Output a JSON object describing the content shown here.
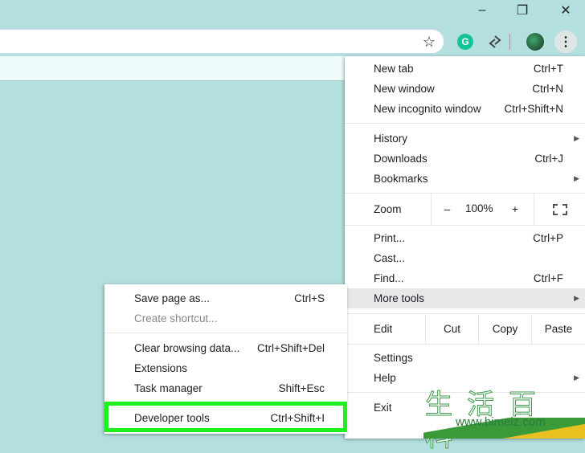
{
  "window": {
    "minimize": "–",
    "restore": "❐",
    "close": "✕"
  },
  "toolbar": {
    "icons": [
      "star-icon",
      "grammarly-icon",
      "extension-icon",
      "avatar",
      "menu-dots-icon"
    ],
    "grammarly_letter": "G",
    "accent": "#15c39a"
  },
  "menu": {
    "top": [
      {
        "label": "New tab",
        "shortcut": "Ctrl+T"
      },
      {
        "label": "New window",
        "shortcut": "Ctrl+N"
      },
      {
        "label": "New incognito window",
        "shortcut": "Ctrl+Shift+N"
      }
    ],
    "mid": [
      {
        "label": "History",
        "shortcut": ""
      },
      {
        "label": "Downloads",
        "shortcut": "Ctrl+J"
      },
      {
        "label": "Bookmarks",
        "shortcut": ""
      }
    ],
    "zoom": {
      "label": "Zoom",
      "minus": "–",
      "value": "100%",
      "plus": "+"
    },
    "tools": [
      {
        "label": "Print...",
        "shortcut": "Ctrl+P"
      },
      {
        "label": "Cast...",
        "shortcut": ""
      },
      {
        "label": "Find...",
        "shortcut": "Ctrl+F"
      },
      {
        "label": "More tools",
        "shortcut": ""
      }
    ],
    "edit": {
      "label": "Edit",
      "cut": "Cut",
      "copy": "Copy",
      "paste": "Paste"
    },
    "bottom": [
      {
        "label": "Settings"
      },
      {
        "label": "Help"
      }
    ],
    "exit": "Exit"
  },
  "submenu": {
    "items": [
      {
        "label": "Save page as...",
        "shortcut": "Ctrl+S"
      },
      {
        "label": "Create shortcut...",
        "shortcut": ""
      },
      {
        "label": "Clear browsing data...",
        "shortcut": "Ctrl+Shift+Del"
      },
      {
        "label": "Extensions",
        "shortcut": ""
      },
      {
        "label": "Task manager",
        "shortcut": "Shift+Esc"
      },
      {
        "label": "Developer tools",
        "shortcut": "Ctrl+Shift+I"
      }
    ],
    "highlight_color": "#1ef01e"
  },
  "watermark": {
    "chars": "生活百科",
    "url": "www.bimeiz.com"
  }
}
